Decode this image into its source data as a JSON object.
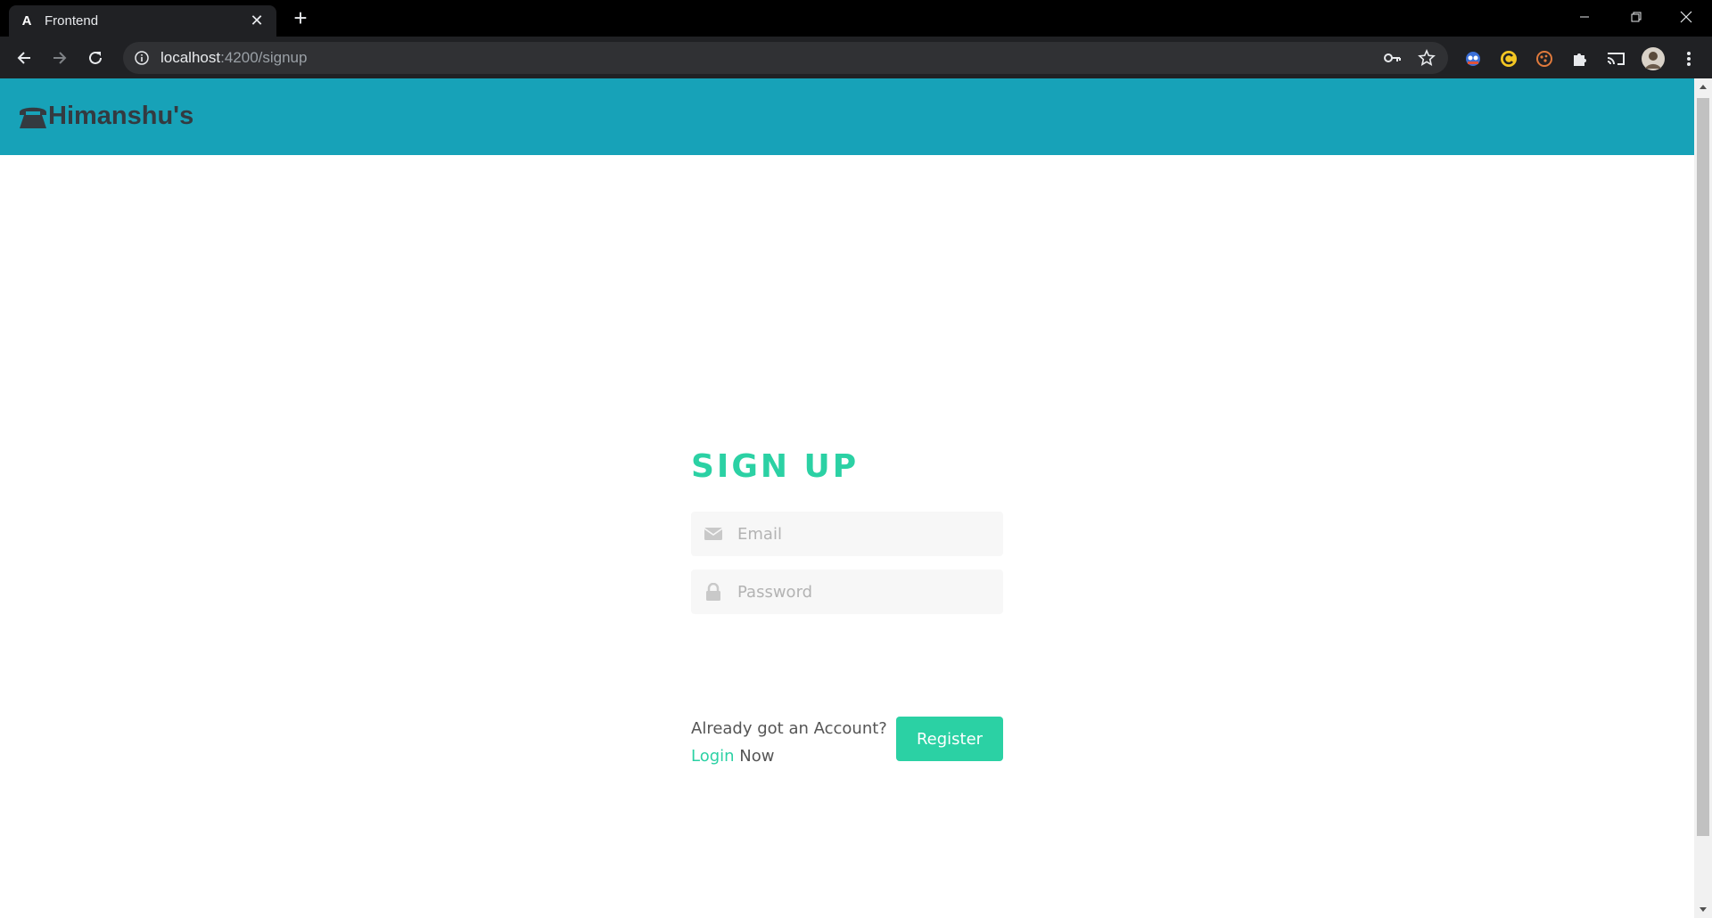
{
  "browser": {
    "tab": {
      "title": "Frontend",
      "favicon": "angular-icon",
      "favicon_glyph": "A"
    },
    "close_glyph": "✕",
    "new_tab_glyph": "+",
    "address": {
      "host": "localhost",
      "rest": ":4200/signup"
    }
  },
  "navbar": {
    "brand": "Himanshu's",
    "brand_icon": "phone-icon",
    "color": "#17a2b8"
  },
  "signup": {
    "title": "SIGN UP",
    "email_placeholder": "Email",
    "password_placeholder": "Password",
    "helper_text": "Already got an Account?",
    "login_link": "Login",
    "helper_suffix": "Now",
    "register_label": "Register",
    "accent_color": "#2bd1a4"
  }
}
